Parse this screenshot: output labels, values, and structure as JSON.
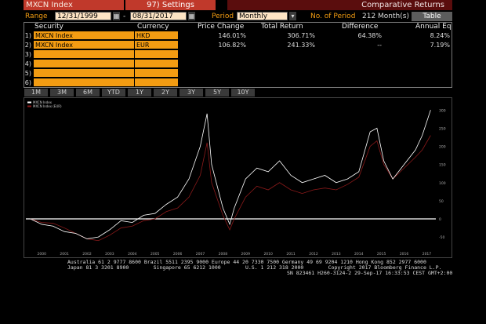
{
  "header": {
    "ticker_field": "MXCN Index",
    "settings_label": "97) Settings",
    "right_title": "Comparative Returns"
  },
  "controls": {
    "range_label": "Range",
    "start_date": "12/31/1999",
    "end_date": "08/31/2017",
    "period_label": "Period",
    "period_value": "Monthly",
    "num_period_label": "No. of Period",
    "num_period_value": "212 Month(s)",
    "table_button": "Table"
  },
  "table": {
    "headers": [
      "Security",
      "Currency",
      "Price Change",
      "Total Return",
      "Difference",
      "Annual Eq"
    ],
    "rows": [
      {
        "num": "1)",
        "security": "MXCN Index",
        "currency": "HKD",
        "price_change": "146.01%",
        "total_return": "306.71%",
        "difference": "64.38%",
        "annual_eq": "8.24%"
      },
      {
        "num": "2)",
        "security": "MXCN Index",
        "currency": "EUR",
        "price_change": "106.82%",
        "total_return": "241.33%",
        "difference": "--",
        "annual_eq": "7.19%"
      },
      {
        "num": "3)",
        "security": "",
        "currency": "",
        "price_change": "",
        "total_return": "",
        "difference": "",
        "annual_eq": ""
      },
      {
        "num": "4)",
        "security": "",
        "currency": "",
        "price_change": "",
        "total_return": "",
        "difference": "",
        "annual_eq": ""
      },
      {
        "num": "5)",
        "security": "",
        "currency": "",
        "price_change": "",
        "total_return": "",
        "difference": "",
        "annual_eq": ""
      },
      {
        "num": "6)",
        "security": "",
        "currency": "",
        "price_change": "",
        "total_return": "",
        "difference": "",
        "annual_eq": ""
      }
    ]
  },
  "tabs": [
    "1M",
    "3M",
    "6M",
    "YTD",
    "1Y",
    "2Y",
    "3Y",
    "5Y",
    "10Y"
  ],
  "footer": {
    "line1": "Australia 61 2 9777 8600 Brazil 5511 2395 9000 Europe 44 20 7330 7500 Germany 49 69 9204 1210 Hong Kong 852 2977 6000",
    "line2": "Japan 81 3 3201 8900        Singapore 65 6212 1000        U.S. 1 212 318 2000        Copyright 2017 Bloomberg Finance L.P.",
    "line3": "SN 823461 H260-3124-2 29-Sep-17 16:33:53 CEST GMT+2:00"
  },
  "colors": {
    "accent_orange": "#f39c12",
    "title_red": "#c0392b",
    "series1": "#ffffff",
    "series2": "#8b1a1a"
  },
  "chart_data": {
    "type": "line",
    "legend_placement": "top-left",
    "x_ticks": [
      "2000",
      "2001",
      "2002",
      "2003",
      "2004",
      "2005",
      "2006",
      "2007",
      "2008",
      "2009",
      "2010",
      "2011",
      "2012",
      "2013",
      "2014",
      "2015",
      "2016",
      "2017"
    ],
    "y_ticks": [
      "300",
      "250",
      "200",
      "150",
      "100",
      "50",
      "0",
      "-50"
    ],
    "ylim": [
      -80,
      320
    ],
    "grid": false,
    "series": [
      {
        "name": "MXCN Index",
        "color": "#ffffff",
        "x": [
          2000,
          2000.5,
          2001,
          2001.5,
          2002,
          2002.5,
          2003,
          2003.5,
          2004,
          2004.5,
          2005,
          2005.5,
          2006,
          2006.5,
          2007,
          2007.5,
          2007.8,
          2008,
          2008.5,
          2008.8,
          2009,
          2009.5,
          2010,
          2010.5,
          2011,
          2011.5,
          2012,
          2012.5,
          2013,
          2013.5,
          2014,
          2014.5,
          2015,
          2015.3,
          2015.6,
          2016,
          2016.5,
          2017,
          2017.3,
          2017.67
        ],
        "y": [
          0,
          -15,
          -20,
          -35,
          -40,
          -55,
          -50,
          -30,
          -5,
          -10,
          10,
          15,
          40,
          60,
          110,
          200,
          290,
          150,
          30,
          -15,
          30,
          110,
          140,
          130,
          160,
          120,
          100,
          110,
          120,
          100,
          110,
          130,
          240,
          250,
          160,
          110,
          150,
          190,
          230,
          300
        ]
      },
      {
        "name": "MXCN Index (EUR)",
        "color": "#8b1a1a",
        "x": [
          2000,
          2000.5,
          2001,
          2001.5,
          2002,
          2002.5,
          2003,
          2003.5,
          2004,
          2004.5,
          2005,
          2005.5,
          2006,
          2006.5,
          2007,
          2007.5,
          2007.8,
          2008,
          2008.5,
          2008.8,
          2009,
          2009.5,
          2010,
          2010.5,
          2011,
          2011.5,
          2012,
          2012.5,
          2013,
          2013.5,
          2014,
          2014.5,
          2015,
          2015.3,
          2015.6,
          2016,
          2016.5,
          2017,
          2017.3,
          2017.67
        ],
        "y": [
          0,
          -10,
          -12,
          -25,
          -40,
          -55,
          -60,
          -45,
          -25,
          -20,
          -5,
          0,
          20,
          30,
          60,
          120,
          210,
          100,
          10,
          -30,
          0,
          60,
          90,
          80,
          100,
          80,
          70,
          80,
          85,
          80,
          95,
          115,
          200,
          215,
          150,
          110,
          140,
          170,
          190,
          230
        ]
      }
    ]
  }
}
